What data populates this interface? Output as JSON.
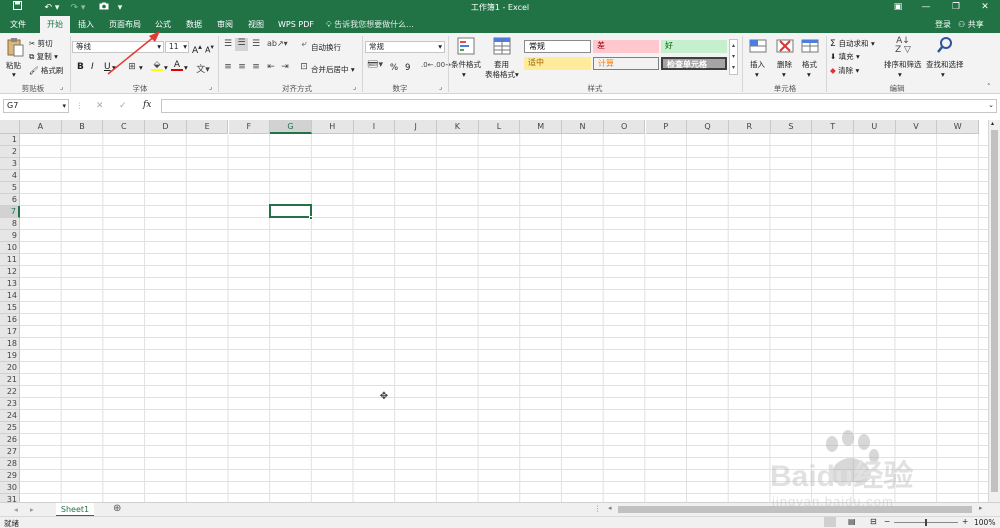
{
  "titlebar": {
    "title": "工作簿1 - Excel",
    "qat_icons": [
      "save-icon",
      "undo-icon",
      "redo-icon",
      "camera-icon"
    ]
  },
  "tabs": [
    {
      "label": "文件",
      "active": false
    },
    {
      "label": "开始",
      "active": true
    },
    {
      "label": "插入",
      "active": false
    },
    {
      "label": "页面布局",
      "active": false
    },
    {
      "label": "公式",
      "active": false
    },
    {
      "label": "数据",
      "active": false
    },
    {
      "label": "审阅",
      "active": false
    },
    {
      "label": "视图",
      "active": false
    },
    {
      "label": "WPS PDF",
      "active": false
    }
  ],
  "tell_me": "告诉我您想要做什么...",
  "account": {
    "login": "登录",
    "share": "共享"
  },
  "ribbon": {
    "clipboard": {
      "paste": "粘贴",
      "cut": "剪切",
      "copy": "复制",
      "format_painter": "格式刷",
      "label": "剪贴板"
    },
    "font": {
      "name": "等线",
      "size": "11",
      "bold": "B",
      "italic": "I",
      "underline": "U",
      "grow": "A",
      "shrink": "A",
      "label": "字体"
    },
    "alignment": {
      "wrap": "自动换行",
      "merge": "合并后居中",
      "label": "对齐方式"
    },
    "number": {
      "format": "常规",
      "percent": "%",
      "comma": "9",
      "label": "数字"
    },
    "styles": {
      "conditional": "条件格式",
      "table": "套用",
      "table2": "表格格式",
      "cells": [
        {
          "label": "常规",
          "bg": "#ffffff",
          "fg": "#000000"
        },
        {
          "label": "差",
          "bg": "#ffc7ce",
          "fg": "#9c0006"
        },
        {
          "label": "好",
          "bg": "#c6efce",
          "fg": "#006100"
        },
        {
          "label": "适中",
          "bg": "#ffeb9c",
          "fg": "#9c6500"
        },
        {
          "label": "计算",
          "bg": "#f2f2f2",
          "fg": "#fa7d00"
        },
        {
          "label": "检查单元格",
          "bg": "#a5a5a5",
          "fg": "#ffffff"
        }
      ],
      "label": "样式"
    },
    "cells": {
      "insert": "插入",
      "delete": "删除",
      "format": "格式",
      "label": "单元格"
    },
    "editing": {
      "autosum": "自动求和",
      "fill": "填充",
      "clear": "清除",
      "sort": "排序和筛选",
      "find": "查找和选择",
      "label": "编辑"
    }
  },
  "formula_bar": {
    "name_box": "G7",
    "cancel": "✕",
    "enter": "✓",
    "fx": "fx",
    "value": ""
  },
  "columns": [
    "A",
    "B",
    "C",
    "D",
    "E",
    "F",
    "G",
    "H",
    "I",
    "J",
    "K",
    "L",
    "M",
    "N",
    "O",
    "P",
    "Q",
    "R",
    "S",
    "T",
    "U",
    "V",
    "W"
  ],
  "rows": [
    "1",
    "2",
    "3",
    "4",
    "5",
    "6",
    "7",
    "8",
    "9",
    "10",
    "11",
    "12",
    "13",
    "14",
    "15",
    "16",
    "17",
    "18",
    "19",
    "20",
    "21",
    "22",
    "23",
    "24",
    "25",
    "26",
    "27",
    "28",
    "29",
    "30",
    "31"
  ],
  "selected": {
    "col": "G",
    "row": "7"
  },
  "sheets": [
    {
      "name": "Sheet1",
      "active": true
    }
  ],
  "status": {
    "ready": "就绪",
    "zoom": "100%"
  },
  "watermark": {
    "brand": "Baidu经验",
    "url": "jingyan.baidu.com"
  },
  "colors": {
    "accent": "#217346",
    "annotation": "#e53935"
  }
}
